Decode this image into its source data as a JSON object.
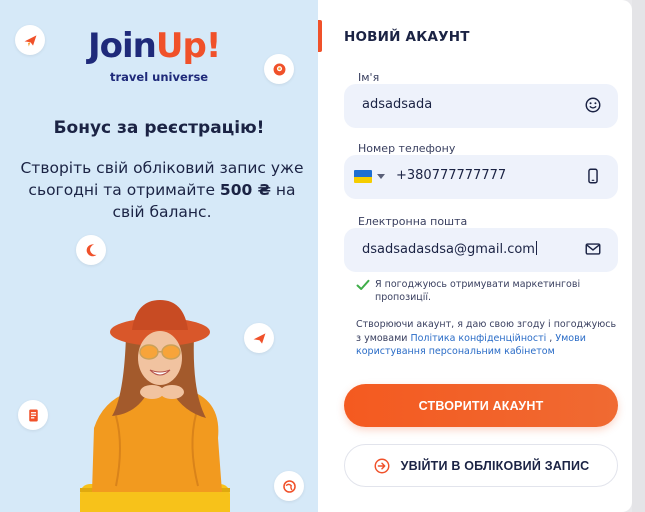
{
  "promo": {
    "logo_main": "Join",
    "logo_accent": "Up!",
    "logo_sub": "travel universe",
    "title": "Бонус за реєстрацію!",
    "text_before": "Створіть свій обліковий запис уже сьогодні та отримайте ",
    "text_bold": "500 ₴",
    "text_after": " на свій баланс."
  },
  "form": {
    "title": "НОВИЙ АКАУНТ",
    "name": {
      "label": "Ім'я",
      "value": "adsadsada",
      "icon": "emoji-smile-icon"
    },
    "phone": {
      "label": "Номер телефону",
      "value": "+380777777777",
      "country": "UA",
      "icon": "mobile-phone-icon"
    },
    "email": {
      "label": "Електронна пошта",
      "value": "dsadsadasdsa@gmail.com",
      "icon": "envelope-icon"
    },
    "consent": {
      "checked": true,
      "text": "Я погоджуюсь отримувати маркетингові пропозиції."
    },
    "terms": {
      "text_before": "Створюючи акаунт, я даю свою згоду і погоджуюсь з умовами ",
      "privacy_link": "Політика конфіденційності",
      "separator": " , ",
      "cabinet_link": "Умови користування персональним кабінетом"
    },
    "submit_label": "СТВОРИТИ АКАУНТ",
    "login_label": "УВІЙТИ В ОБЛІКОВИЙ ЗАПИС"
  },
  "colors": {
    "accent": "#f0512a",
    "brand_navy": "#1f2a7a",
    "promo_bg": "#d6e9f8",
    "field_bg": "#eef2fb",
    "link": "#2a6cc7",
    "check": "#3fae49"
  }
}
